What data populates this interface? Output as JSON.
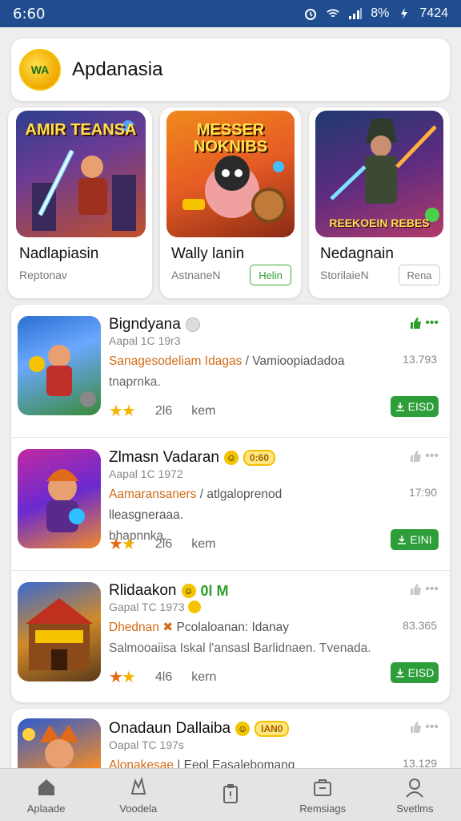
{
  "status_bar": {
    "time": "6:60",
    "battery_text": "8%",
    "clock_right": "7424"
  },
  "header": {
    "title": "Apdanasia",
    "logo_text": "WA"
  },
  "featured": [
    {
      "name": "Nadlapiasin",
      "sub": "Reptonav",
      "button": "",
      "art_title": "AMIR TEANSA",
      "art_sub": ""
    },
    {
      "name": "Wally lanin",
      "sub": "AstnaneN",
      "button": "Helin",
      "art_title": "MESSER NOKNIBS",
      "art_sub": ""
    },
    {
      "name": "Nedagnain",
      "sub": "StorilaieN",
      "button": "Rena",
      "art_title": "",
      "art_sub": "REEKOEIN REBES"
    }
  ],
  "apps": [
    {
      "title": "Bigndyana",
      "subtitle": "Aapal 1C 19r3",
      "desc_highlight": "Sanagesodeliam Idagas",
      "desc_rest": " / Vamioopiadadoa",
      "desc_line2": "tnaprnka.",
      "size": "13.793",
      "rating_count": "2l6",
      "rating_unit": "kem",
      "install_label": "EISD",
      "badge": "",
      "extra": ""
    },
    {
      "title": "Zlmasn Vadaran",
      "subtitle": "Aapal 1C 1972",
      "desc_highlight": "Aamaransaners",
      "desc_rest": " / atlgaloprenod lleasgneraaa.",
      "desc_line2": "bhapnnka.",
      "size": "17:90",
      "rating_count": "2l6",
      "rating_unit": "kem",
      "install_label": "EINI",
      "badge": "0:60",
      "extra": ""
    },
    {
      "title": "Rlidaakon",
      "subtitle": "Gapal TC 1973",
      "desc_highlight": "Dhednan",
      "desc_rest": " Pcolaloanan: Idanay",
      "desc_line2": "Salmooaiisa Iskal l'ansasl Barlidnaen. Tvenada.",
      "size": "83.365",
      "rating_count": "4l6",
      "rating_unit": "kern",
      "install_label": "EISD",
      "badge": "",
      "extra": "0l M"
    },
    {
      "title": "Onadaun Dallaiba",
      "subtitle": "Oapal TC 197s",
      "desc_highlight": "Alonakesae",
      "desc_rest": " | Eeol Easalebomang",
      "desc_line2": "",
      "size": "13.129",
      "rating_count": "",
      "rating_unit": "",
      "install_label": "",
      "badge": "IAN0",
      "extra": ""
    }
  ],
  "nav": [
    {
      "label": "Aplaade",
      "icon": "home-icon"
    },
    {
      "label": "Voodela",
      "icon": "games-icon"
    },
    {
      "label": "",
      "icon": "clipboard-icon"
    },
    {
      "label": "Remsiags",
      "icon": "inbox-icon"
    },
    {
      "label": "Svetlms",
      "icon": "profile-icon"
    }
  ],
  "colors": {
    "status_bar": "#1f4d8f",
    "accent_green": "#2e9e3a",
    "highlight_orange": "#d06a16",
    "star": "#f4b300"
  }
}
